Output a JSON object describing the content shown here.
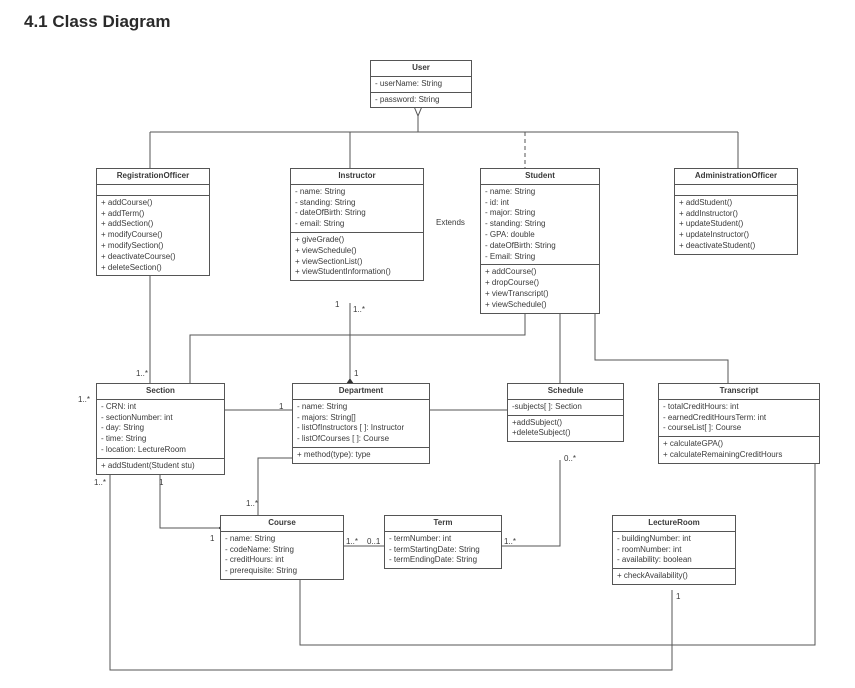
{
  "heading": "4.1 Class Diagram",
  "classes": {
    "User": {
      "name": "User",
      "attrs": [
        "- userName: String",
        "- password: String"
      ],
      "ops": []
    },
    "RegistrationOfficer": {
      "name": "RegistrationOfficer",
      "attrs": [],
      "ops": [
        "+ addCourse()",
        "+ addTerm()",
        "+ addSection()",
        "+ modifyCourse()",
        "+ modifySection()",
        "+ deactivateCourse()",
        "+ deleteSection()"
      ]
    },
    "Instructor": {
      "name": "Instructor",
      "attrs": [
        "- name: String",
        "- standing: String",
        "- dateOfBirth: String",
        "- email: String"
      ],
      "ops": [
        "+ giveGrade()",
        "+ viewSchedule()",
        "+ viewSectionList()",
        "+ viewStudentInformation()"
      ]
    },
    "Student": {
      "name": "Student",
      "attrs": [
        "- name: String",
        "- id: int",
        "- major: String",
        "- standing: String",
        "- GPA: double",
        "- dateOfBirth: String",
        "- Email: String"
      ],
      "ops": [
        "+ addCourse()",
        "+ dropCourse()",
        "+ viewTranscript()",
        "+ viewSchedule()"
      ]
    },
    "AdministrationOfficer": {
      "name": "AdministrationOfficer",
      "attrs": [],
      "ops": [
        "+ addStudent()",
        "+ addInstructor()",
        "+ updateStudent()",
        "+ updateInstructor()",
        "+ deactivateStudent()"
      ]
    },
    "Section": {
      "name": "Section",
      "attrs": [
        "- CRN: int",
        "- sectionNumber: int",
        "- day: String",
        "- time: String",
        "- location: LectureRoom"
      ],
      "ops": [
        "+ addStudent(Student stu)"
      ]
    },
    "Department": {
      "name": "Department",
      "attrs": [
        "- name: String",
        "- majors: String[]",
        "- listOfInstructors [ ]: Instructor",
        "- listOfCourses [ ]: Course"
      ],
      "ops": [
        "+ method(type): type"
      ]
    },
    "Schedule": {
      "name": "Schedule",
      "attrs": [
        "-subjects[ ]: Section"
      ],
      "ops": [
        "+addSubject()",
        "+deleteSubject()"
      ]
    },
    "Transcript": {
      "name": "Transcript",
      "attrs": [
        "- totalCreditHours: int",
        "- earnedCreditHoursTerm: int",
        "- courseList[ ]: Course"
      ],
      "ops": [
        "+ calculateGPA()",
        "+ calculateRemainingCreditHours"
      ]
    },
    "Course": {
      "name": "Course",
      "attrs": [
        "- name: String",
        "- codeName: String",
        "- creditHours: int",
        "- prerequisite: String"
      ],
      "ops": []
    },
    "Term": {
      "name": "Term",
      "attrs": [
        "- termNumber: int",
        "- termStartingDate: String",
        "- termEndingDate: String"
      ],
      "ops": []
    },
    "LectureRoom": {
      "name": "LectureRoom",
      "attrs": [
        "- buildingNumber: int",
        "- roomNumber: int",
        "- availability: boolean"
      ],
      "ops": [
        "+ checkAvailability()"
      ]
    }
  },
  "labels": {
    "extends": "Extends"
  },
  "mult": {
    "inst_dep_top": "1",
    "inst_dep_bot": "1..*",
    "sec_reg": "1..*",
    "sec_sched_left": "1..*",
    "sec_course_top": "1..*",
    "sec_course_bot": "1",
    "sec_dep": "1",
    "dep_course": "1..*",
    "dep_inst": "1",
    "course_term_l": "1..*",
    "course_term_r": "0..1",
    "term_sched": "1..*",
    "sched_student": "0..*",
    "lroom_sec": "1",
    "course_transcript": "1"
  }
}
